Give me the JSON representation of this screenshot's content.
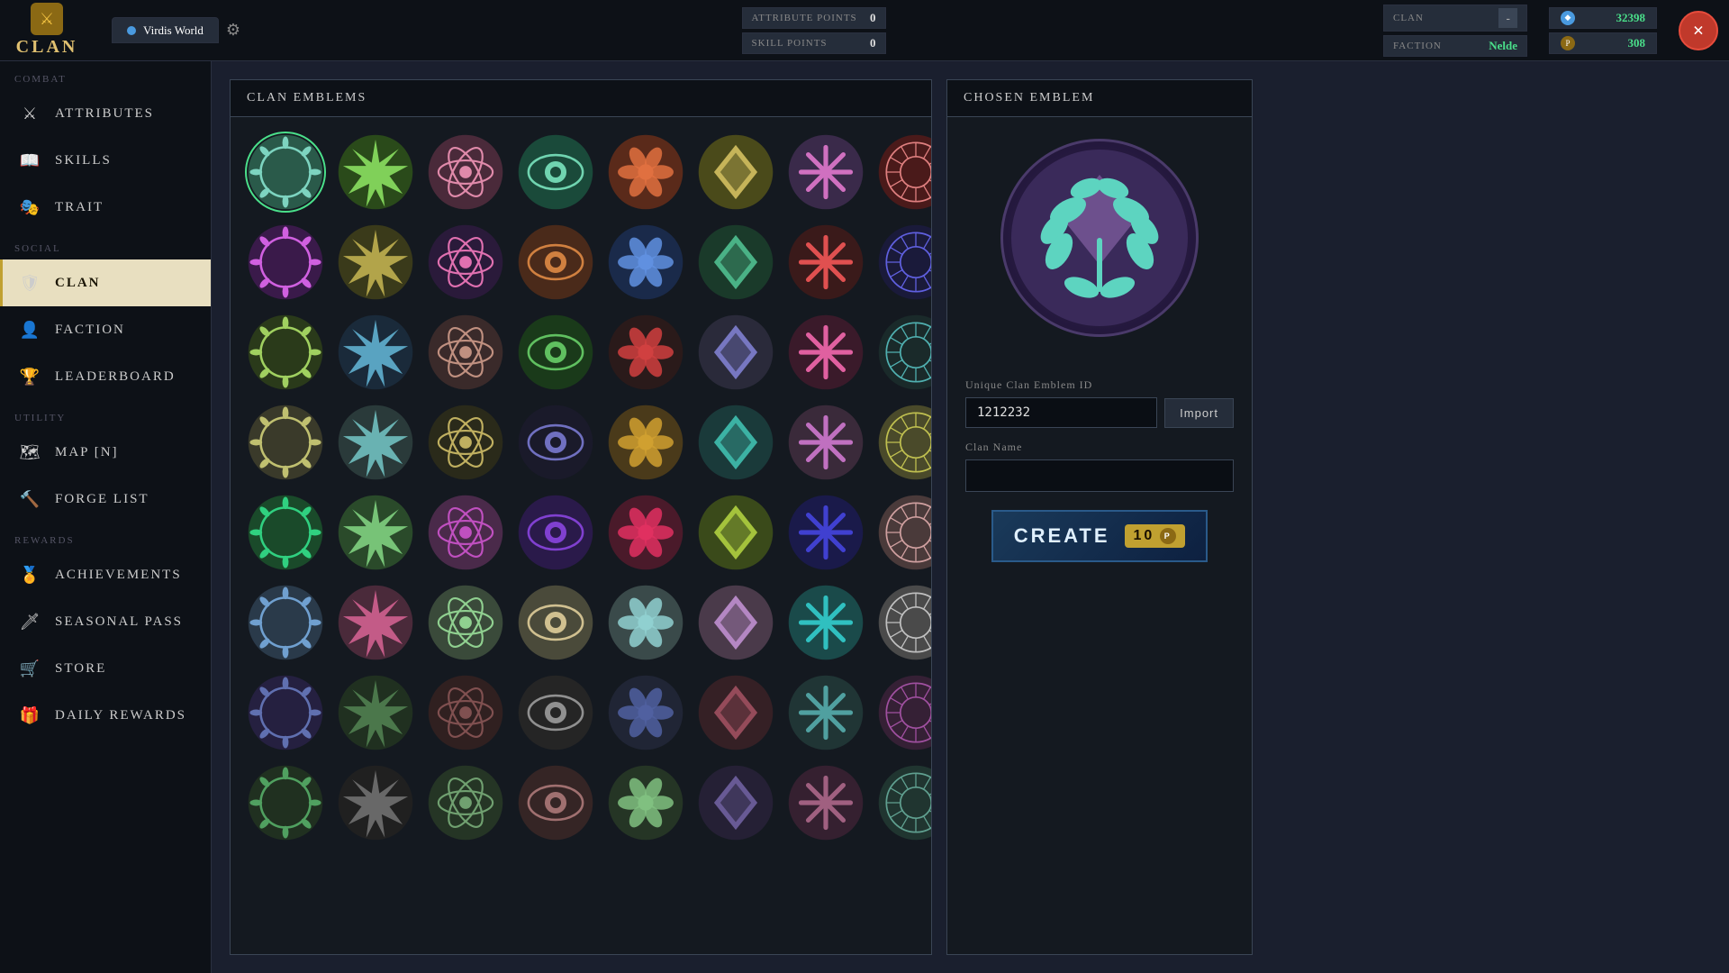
{
  "topbar": {
    "logo_text": "CLAN",
    "tab_active": "Virdis World",
    "attr_points_label": "ATTRIBUTE POINTS",
    "attr_points_value": "0",
    "skill_points_label": "SKILL POINTS",
    "skill_points_value": "0",
    "clan_label": "CLAN",
    "clan_btn": "-",
    "faction_label": "FACTION",
    "faction_value": "Nelde",
    "currency1_value": "32398",
    "currency2_value": "308",
    "close_label": "×"
  },
  "sidebar": {
    "section_combat": "COMBAT",
    "section_social": "SOCIAL",
    "section_utility": "UTILITY",
    "section_rewards": "REWARDS",
    "items": [
      {
        "id": "attributes",
        "label": "ATTRIBUTES",
        "icon": "⚔",
        "active": false
      },
      {
        "id": "skills",
        "label": "SKILLS",
        "icon": "📖",
        "active": false
      },
      {
        "id": "trait",
        "label": "TRAIT",
        "icon": "🎭",
        "active": false
      },
      {
        "id": "clan",
        "label": "CLAN",
        "icon": "🛡",
        "active": true
      },
      {
        "id": "faction",
        "label": "FACTION",
        "icon": "👤",
        "active": false
      },
      {
        "id": "leaderboard",
        "label": "LEADERBOARD",
        "icon": "🏆",
        "active": false
      },
      {
        "id": "map",
        "label": "MAP [N]",
        "icon": "🗺",
        "active": false
      },
      {
        "id": "forge-list",
        "label": "FORGE LIST",
        "icon": "🔨",
        "active": false
      },
      {
        "id": "achievements",
        "label": "ACHIEVEMENTS",
        "icon": "🏅",
        "active": false
      },
      {
        "id": "seasonal-pass",
        "label": "SEASONAL PASS",
        "icon": "🗡",
        "active": false
      },
      {
        "id": "store",
        "label": "STORE",
        "icon": "🛒",
        "active": false
      },
      {
        "id": "daily-rewards",
        "label": "DAILY REWARDS",
        "icon": "🎁",
        "active": false
      }
    ]
  },
  "emblems_panel": {
    "header": "CLAN EMBLEMS"
  },
  "chosen_panel": {
    "header": "CHOSEN EMBLEM",
    "id_label": "Unique Clan Emblem ID",
    "id_value": "1212232",
    "import_label": "Import",
    "name_label": "Clan Name",
    "name_placeholder": "",
    "create_label": "CREATE",
    "create_cost": "10"
  },
  "emblems": [
    {
      "id": 1,
      "bg": "#2a5a4a",
      "fg": "#7dd4c0"
    },
    {
      "id": 2,
      "bg": "#2a4a1a",
      "fg": "#8adf60"
    },
    {
      "id": 3,
      "bg": "#4a2a3a",
      "fg": "#e08aaa"
    },
    {
      "id": 4,
      "bg": "#1a4a3a",
      "fg": "#70d4b0"
    },
    {
      "id": 5,
      "bg": "#5a2a1a",
      "fg": "#e07040"
    },
    {
      "id": 6,
      "bg": "#4a4a1a",
      "fg": "#d4c060"
    },
    {
      "id": 7,
      "bg": "#3a2a4a",
      "fg": "#d070c0"
    },
    {
      "id": 8,
      "bg": "#4a1a1a",
      "fg": "#e08080"
    },
    {
      "id": 9,
      "bg": "#3a1a4a",
      "fg": "#d060e0"
    },
    {
      "id": 10,
      "bg": "#3a3a1a",
      "fg": "#c0b050"
    },
    {
      "id": 11,
      "bg": "#2a1a3a",
      "fg": "#e070b0"
    },
    {
      "id": 12,
      "bg": "#4a2a1a",
      "fg": "#d08040"
    },
    {
      "id": 13,
      "bg": "#1a2a4a",
      "fg": "#6090e0"
    },
    {
      "id": 14,
      "bg": "#1a3a2a",
      "fg": "#50c090"
    },
    {
      "id": 15,
      "bg": "#3a1a1a",
      "fg": "#e05050"
    },
    {
      "id": 16,
      "bg": "#1a1a3a",
      "fg": "#6060e0"
    },
    {
      "id": 17,
      "bg": "#2a3a1a",
      "fg": "#a0d060"
    },
    {
      "id": 18,
      "bg": "#1a2a3a",
      "fg": "#60b0d0"
    },
    {
      "id": 19,
      "bg": "#3a2a2a",
      "fg": "#c09080"
    },
    {
      "id": 20,
      "bg": "#1a3a1a",
      "fg": "#60c060"
    },
    {
      "id": 21,
      "bg": "#2a1a1a",
      "fg": "#d04040"
    },
    {
      "id": 22,
      "bg": "#2a2a3a",
      "fg": "#8080d0"
    },
    {
      "id": 23,
      "bg": "#3a1a2a",
      "fg": "#e060a0"
    },
    {
      "id": 24,
      "bg": "#1a2a2a",
      "fg": "#50b0b0"
    },
    {
      "id": 25,
      "bg": "#3a3a2a",
      "fg": "#c0c070"
    },
    {
      "id": 26,
      "bg": "#2a3a3a",
      "fg": "#70c0c0"
    },
    {
      "id": 27,
      "bg": "#2a2a1a",
      "fg": "#c0b060"
    },
    {
      "id": 28,
      "bg": "#1a1a2a",
      "fg": "#7070c0"
    },
    {
      "id": 29,
      "bg": "#4a3a1a",
      "fg": "#d0a030"
    },
    {
      "id": 30,
      "bg": "#1a3a3a",
      "fg": "#40c0b0"
    },
    {
      "id": 31,
      "bg": "#3a2a3a",
      "fg": "#c070c0"
    },
    {
      "id": 32,
      "bg": "#4a4a2a",
      "fg": "#c0c050"
    },
    {
      "id": 33,
      "bg": "#1a4a2a",
      "fg": "#30d080"
    },
    {
      "id": 34,
      "bg": "#2a4a2a",
      "fg": "#80d080"
    },
    {
      "id": 35,
      "bg": "#4a2a4a",
      "fg": "#c050c0"
    },
    {
      "id": 36,
      "bg": "#2a1a4a",
      "fg": "#8040d0"
    },
    {
      "id": 37,
      "bg": "#4a1a2a",
      "fg": "#e03060"
    },
    {
      "id": 38,
      "bg": "#3a4a1a",
      "fg": "#b0d040"
    },
    {
      "id": 39,
      "bg": "#1a1a4a",
      "fg": "#4040d0"
    },
    {
      "id": 40,
      "bg": "#4a3a3a",
      "fg": "#d0a0a0"
    },
    {
      "id": 41,
      "bg": "#2a3a4a",
      "fg": "#70a0d0"
    },
    {
      "id": 42,
      "bg": "#4a2a3a",
      "fg": "#d06090"
    },
    {
      "id": 43,
      "bg": "#3a4a3a",
      "fg": "#90d090"
    },
    {
      "id": 44,
      "bg": "#4a4a3a",
      "fg": "#d0c090"
    },
    {
      "id": 45,
      "bg": "#3a4a4a",
      "fg": "#90d0d0"
    },
    {
      "id": 46,
      "bg": "#4a3a4a",
      "fg": "#c090d0"
    },
    {
      "id": 47,
      "bg": "#1a4a4a",
      "fg": "#30c0c0"
    },
    {
      "id": 48,
      "bg": "#4a4a4a",
      "fg": "#c0c0c0"
    },
    {
      "id": 49,
      "bg": "#252040",
      "fg": "#6070b0"
    },
    {
      "id": 50,
      "bg": "#203020",
      "fg": "#508050"
    },
    {
      "id": 51,
      "bg": "#302020",
      "fg": "#805050"
    },
    {
      "id": 52,
      "bg": "#252525",
      "fg": "#909090"
    },
    {
      "id": 53,
      "bg": "#202535",
      "fg": "#5060a0"
    },
    {
      "id": 54,
      "bg": "#352025",
      "fg": "#a05060"
    },
    {
      "id": 55,
      "bg": "#203535",
      "fg": "#50a0a0"
    },
    {
      "id": 56,
      "bg": "#352035",
      "fg": "#a050a0"
    },
    {
      "id": 57,
      "bg": "#203020",
      "fg": "#50a060"
    },
    {
      "id": 58,
      "bg": "#202020",
      "fg": "#707070"
    },
    {
      "id": 59,
      "bg": "#253525",
      "fg": "#70a070"
    },
    {
      "id": 60,
      "bg": "#352525",
      "fg": "#a07070"
    },
    {
      "id": 61,
      "bg": "#253525",
      "fg": "#80c080"
    },
    {
      "id": 62,
      "bg": "#252035",
      "fg": "#7060a0"
    },
    {
      "id": 63,
      "bg": "#352030",
      "fg": "#a06080"
    },
    {
      "id": 64,
      "bg": "#203530",
      "fg": "#60a090"
    }
  ]
}
